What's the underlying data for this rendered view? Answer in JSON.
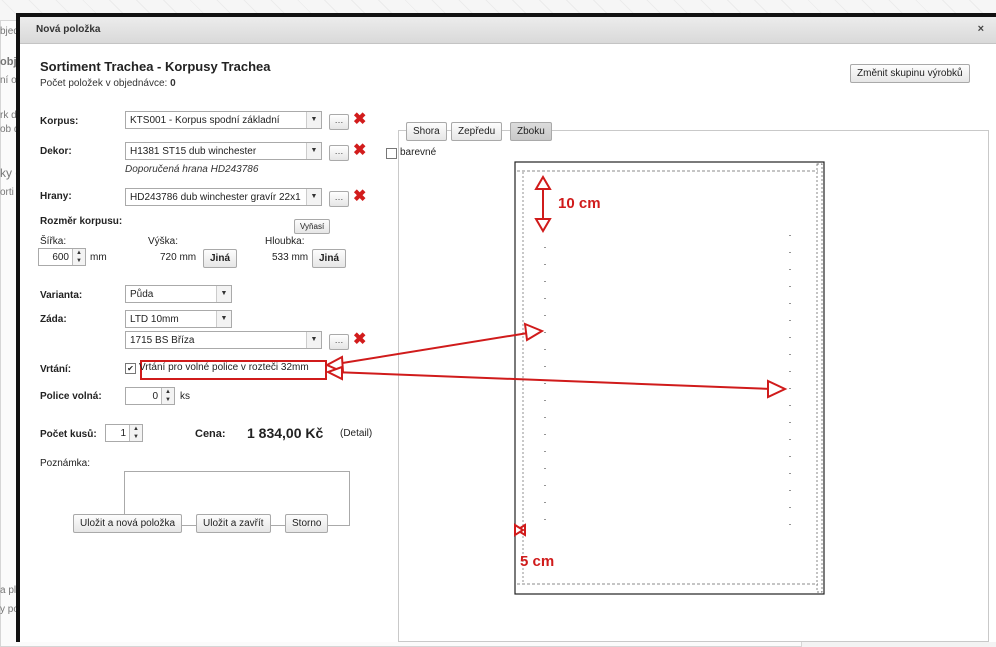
{
  "background": {
    "fragments": [
      "bjed",
      "obj",
      "ní ob",
      "rk dod",
      "ob d",
      "ky d",
      "orti",
      "a pl",
      "y po"
    ]
  },
  "dialog": {
    "title": "Nová položka",
    "close": "×",
    "heading": "Sortiment Trachea - Korpusy Trachea",
    "count_label": "Počet položek v objednávce:",
    "count_value": "0",
    "change_group_button": "Změnit skupinu výrobků"
  },
  "form": {
    "korpus": {
      "label": "Korpus:",
      "value": "KTS001 - Korpus spodní základní"
    },
    "dekor": {
      "label": "Dekor:",
      "value": "H1381 ST15 dub winchester",
      "hint": "Doporučená hrana HD243786"
    },
    "hrany": {
      "label": "Hrany:",
      "value": "HD243786 dub winchester gravír 22x1"
    },
    "rozmer": {
      "label": "Rozměr korpusu:",
      "reset_button": "Vyňasí",
      "sirka_label": "Šířka:",
      "sirka_value": "600",
      "sirka_unit": "mm",
      "vyska_label": "Výška:",
      "vyska_value": "720 mm",
      "vyska_button": "Jiná",
      "hloubka_label": "Hloubka:",
      "hloubka_value": "533 mm",
      "hloubka_button": "Jiná"
    },
    "varianta": {
      "label": "Varianta:",
      "value": "Půda"
    },
    "zada": {
      "label": "Záda:",
      "value": "LTD 10mm",
      "value2": "1715 BS Bříza"
    },
    "vrtani": {
      "label": "Vrtání:",
      "checkbox_label": "Vrtání pro volné police v rozteči 32mm",
      "checked": true
    },
    "police": {
      "label": "Police volná:",
      "value": "0",
      "unit": "ks"
    },
    "pocet": {
      "label": "Počet kusů:",
      "value": "1"
    },
    "cena": {
      "label": "Cena:",
      "value": "1 834,00 Kč",
      "detail": "(Detail)"
    },
    "poznamka": {
      "label": "Poznámka:"
    },
    "buttons": {
      "save_new": "Uložit a nová položka",
      "save_close": "Uložit a zavřít",
      "cancel": "Storno"
    }
  },
  "preview": {
    "view_buttons": [
      "Shora",
      "Zepředu",
      "Zboku"
    ],
    "active_view": "Zboku",
    "color_checkbox": "barevné",
    "annotation_top": "10 cm",
    "annotation_bottom": "5 cm"
  },
  "colors": {
    "annotation": "#d01b1b"
  }
}
